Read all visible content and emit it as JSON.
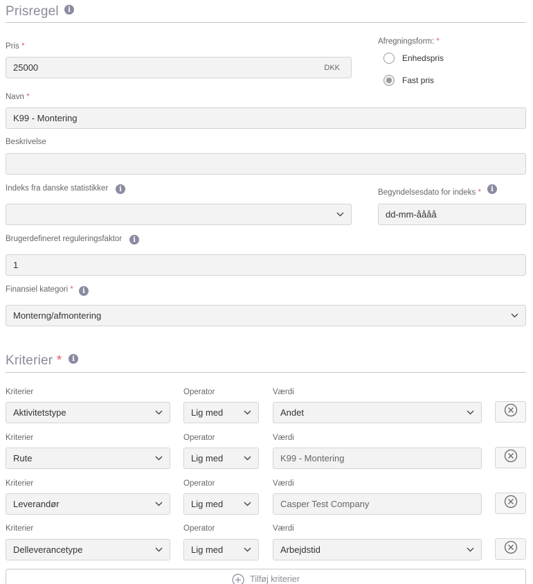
{
  "prisregel": {
    "title": "Prisregel",
    "pris": {
      "label": "Pris",
      "required_mark": "*",
      "value": "25000",
      "suffix": "DKK"
    },
    "afregningsform": {
      "label": "Afregningsform:",
      "required_mark": "*",
      "options": [
        {
          "label": "Enhedspris",
          "checked": false
        },
        {
          "label": "Fast pris",
          "checked": true
        }
      ]
    },
    "navn": {
      "label": "Navn",
      "required_mark": "*",
      "value": "K99 - Montering"
    },
    "beskrivelse": {
      "label": "Beskrivelse",
      "value": ""
    },
    "indeks": {
      "label": "Indeks fra danske statistikker",
      "value": ""
    },
    "begyndelsesdato": {
      "label": "Begyndelsesdato for indeks",
      "required_mark": "*",
      "value": "dd-mm-åååå"
    },
    "reguleringsfaktor": {
      "label": "Brugerdefineret reguleringsfaktor",
      "value": "1"
    },
    "finansiel_kategori": {
      "label": "Finansiel kategori",
      "required_mark": "*",
      "value": "Monterng/afmontering"
    }
  },
  "kriterier": {
    "title": "Kriterier",
    "required_mark": "*",
    "rows": [
      {
        "kriterie_label": "Kriterier",
        "kriterie": "Aktivitetstype",
        "operator_label": "Operator",
        "operator": "Lig med",
        "vaerdi_label": "Værdi",
        "vaerdi": "Andet"
      },
      {
        "kriterie_label": "Kriterier",
        "kriterie": "Rute",
        "operator_label": "Operator",
        "operator": "Lig med",
        "vaerdi_label": "Værdi",
        "vaerdi": "K99 - Montering"
      },
      {
        "kriterie_label": "Kriterier",
        "kriterie": "Leverandør",
        "operator_label": "Operator",
        "operator": "Lig med",
        "vaerdi_label": "Værdi",
        "vaerdi": "Casper Test Company"
      },
      {
        "kriterie_label": "Kriterier",
        "kriterie": "Delleverancetype",
        "operator_label": "Operator",
        "operator": "Lig med",
        "vaerdi_label": "Værdi",
        "vaerdi": "Arbejdstid"
      }
    ],
    "add_button_label": "Tilføj kriterier"
  },
  "icons": {
    "info": "info-icon",
    "chevron": "chevron-down-icon",
    "remove": "close-circle-icon",
    "add": "plus-circle-icon"
  },
  "colors": {
    "title": "#8a8a9a",
    "required": "#e0606a",
    "field_bg": "#f3f3f3",
    "field_border": "#d4d4d4",
    "info_icon": "#8a8aa0"
  }
}
